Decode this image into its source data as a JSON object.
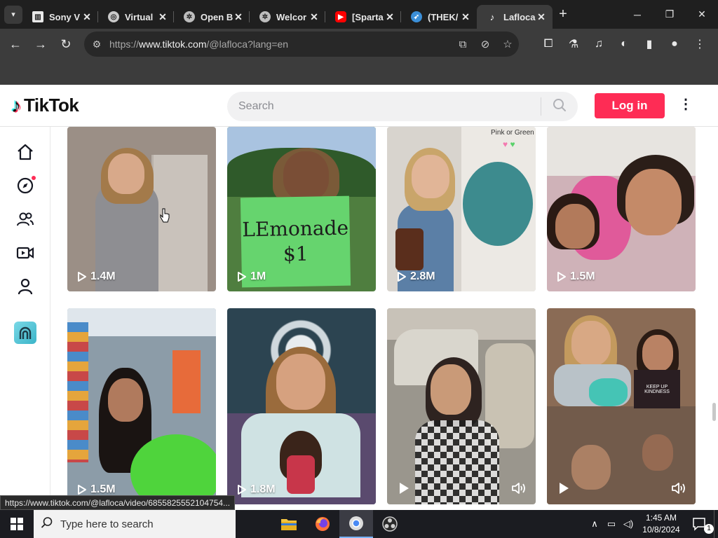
{
  "browser": {
    "tabs": [
      {
        "title": "Sony V",
        "favicon": "columns-icon",
        "active": false
      },
      {
        "title": "Virtual",
        "favicon": "globe-icon",
        "active": false
      },
      {
        "title": "Open B",
        "favicon": "openai-icon",
        "active": false
      },
      {
        "title": "Welcor",
        "favicon": "openai-icon",
        "active": false
      },
      {
        "title": "[Sparta",
        "favicon": "youtube-icon",
        "active": false
      },
      {
        "title": "(THEK/",
        "favicon": "bird-icon",
        "active": false
      },
      {
        "title": "Lafloca",
        "favicon": "tiktok-icon",
        "active": true
      }
    ],
    "url_prefix": "https://",
    "url_host": "www.tiktok.com",
    "url_path": "/@lafloca?lang=en",
    "status_url": "https://www.tiktok.com/@lafloca/video/6855825552104754..."
  },
  "tiktok": {
    "brand": "TikTok",
    "search_placeholder": "Search",
    "login_label": "Log in",
    "sidebar": [
      "home-icon",
      "explore-icon",
      "following-icon",
      "live-icon",
      "profile-icon",
      "creator-tools-icon"
    ],
    "accent": "#fe2c55"
  },
  "videos": [
    {
      "views": "1.4M",
      "bg": "#9b8f86",
      "caption": ""
    },
    {
      "views": "1M",
      "bg": "#4f7e3f",
      "caption": "LEmonade\n$1"
    },
    {
      "views": "2.8M",
      "bg": "#d8d4ce",
      "caption": "Pink or Green"
    },
    {
      "views": "1.5M",
      "bg": "#cfb2b8",
      "caption": ""
    },
    {
      "views": "1.5M",
      "bg": "#8c9ca8",
      "caption": ""
    },
    {
      "views": "1.8M",
      "bg": "#2c4451",
      "caption": ""
    },
    {
      "views": "",
      "bg": "#9a968d",
      "caption": ""
    },
    {
      "views": "",
      "bg": "#8a6b55",
      "caption": "KEEP UP KINDNESS"
    }
  ],
  "taskbar": {
    "search_placeholder": "Type here to search",
    "time": "1:45 AM",
    "date": "10/8/2024",
    "notification_count": "1"
  }
}
